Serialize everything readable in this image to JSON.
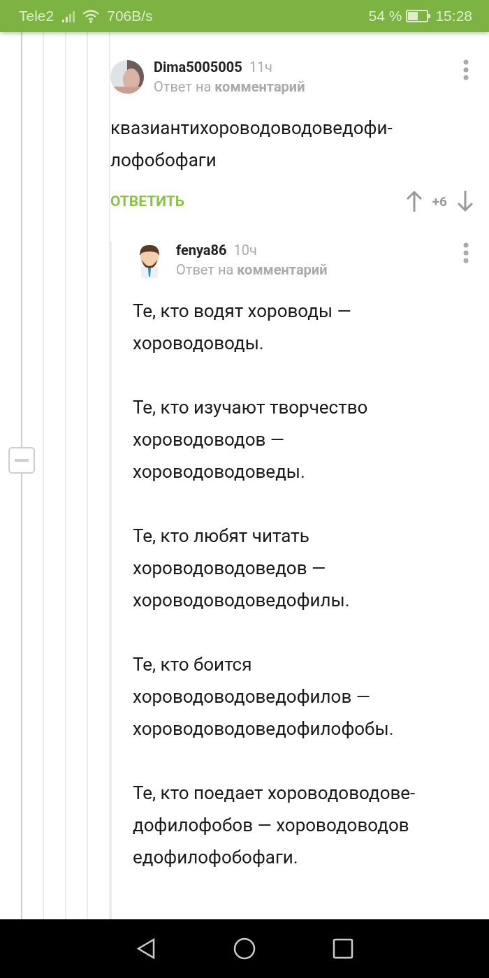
{
  "status_bar": {
    "carrier": "Tele2",
    "speed": "706B/s",
    "battery": "54 %",
    "time": "15:28"
  },
  "comments": [
    {
      "author": "Dima5005005",
      "time": "11ч",
      "reply_prefix": "Ответ на",
      "reply_target": "комментарий",
      "avatar": {
        "kind": "photo"
      },
      "paragraphs": [
        [
          "квазиантихороводоводоведофи-",
          "лофобофаги"
        ]
      ],
      "reply_label": "ОТВЕТИТЬ",
      "rating": "+6"
    },
    {
      "author": "fenya86",
      "time": "10ч",
      "reply_prefix": "Ответ на",
      "reply_target": "комментарий",
      "avatar": {
        "kind": "drawing"
      },
      "paragraphs": [
        [
          "Те, кто водят хороводы —",
          "хороводоводы."
        ],
        [
          "Те, кто изучают творчество",
          "хороводоводов —",
          "хороводоводоведы."
        ],
        [
          "Те, кто любят читать",
          "хороводоводоведов —",
          "хороводоводоведофилы."
        ],
        [
          "Те, кто боится",
          "хороводоводоведофилов —",
          "хороводоводоведофилофобы."
        ],
        [
          "Те, кто поедает хороводоводове-",
          "дофилофобов — хороводоводов",
          "едофилофобофаги."
        ]
      ]
    }
  ]
}
